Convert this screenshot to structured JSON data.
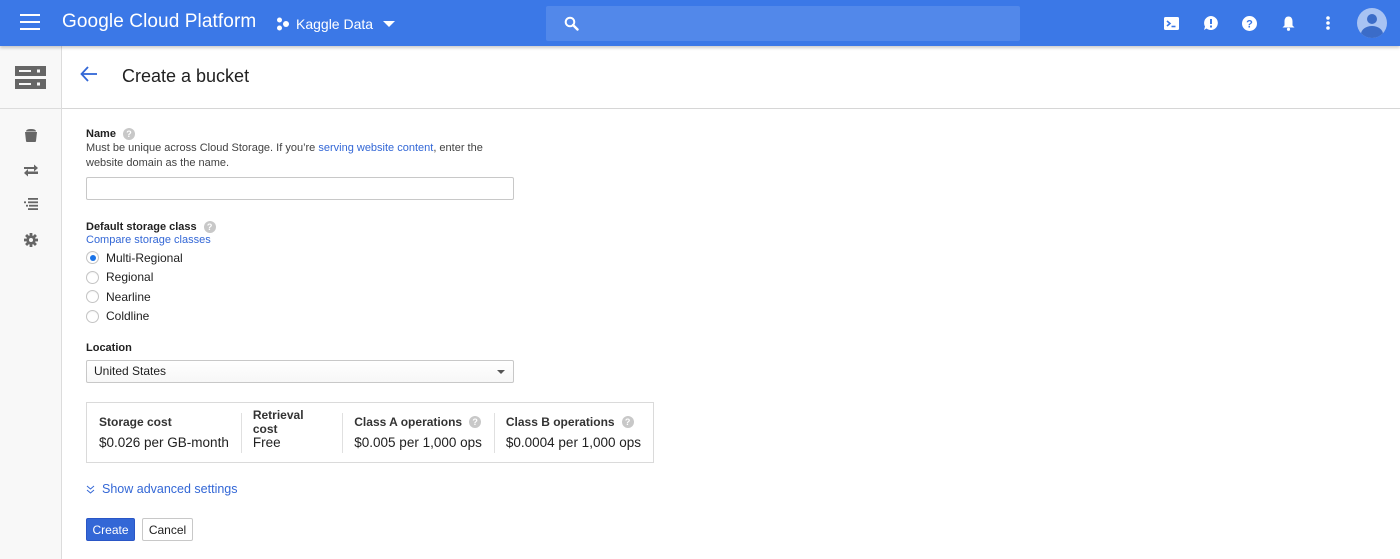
{
  "topbar": {
    "app_title": "Google Cloud Platform",
    "project_name": "Kaggle Data",
    "search_placeholder": "",
    "brand_color": "#3b78e7",
    "icons": [
      "menu-icon",
      "project-icon",
      "search-icon",
      "cloud-shell-icon",
      "feedback-icon",
      "help-icon",
      "notifications-icon",
      "more-vert-icon",
      "account-avatar"
    ]
  },
  "leftnav": {
    "product_icon": "storage-icon",
    "items": [
      {
        "icon": "bucket-icon",
        "label": "Browser"
      },
      {
        "icon": "transfer-icon",
        "label": "Transfer"
      },
      {
        "icon": "transfer-appliance-icon",
        "label": "Transfer Appliance"
      },
      {
        "icon": "settings-icon",
        "label": "Settings"
      }
    ]
  },
  "header": {
    "title": "Create a bucket"
  },
  "form": {
    "name": {
      "label": "Name",
      "desc_before": "Must be unique across Cloud Storage. If you’re ",
      "desc_link": "serving website content",
      "desc_after": ", enter the website domain as the name.",
      "value": ""
    },
    "storage_class": {
      "label": "Default storage class",
      "compare_link": "Compare storage classes",
      "options": [
        {
          "label": "Multi-Regional",
          "selected": true
        },
        {
          "label": "Regional",
          "selected": false
        },
        {
          "label": "Nearline",
          "selected": false
        },
        {
          "label": "Coldline",
          "selected": false
        }
      ]
    },
    "location": {
      "label": "Location",
      "selected": "United States"
    },
    "costs": [
      {
        "title": "Storage cost",
        "value": "$0.026 per GB-month",
        "help": false
      },
      {
        "title": "Retrieval cost",
        "value": "Free",
        "help": false
      },
      {
        "title": "Class A operations",
        "value": "$0.005 per 1,000 ops",
        "help": true
      },
      {
        "title": "Class B operations",
        "value": "$0.0004 per 1,000 ops",
        "help": true
      }
    ],
    "advanced_link": "Show advanced settings",
    "create_label": "Create",
    "cancel_label": "Cancel",
    "help_glyph": "?"
  }
}
